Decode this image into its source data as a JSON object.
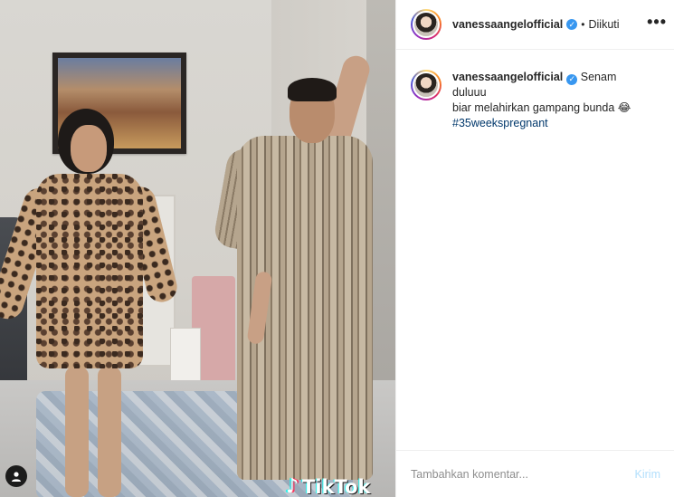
{
  "post": {
    "username": "vanessaangelofficial",
    "follow_separator": "•",
    "follow_status": "Diikuti",
    "more_icon": "•••",
    "caption_line1": "Senam duluuu",
    "caption_line2": "biar melahirkan gampang bunda",
    "caption_emoji": "😂",
    "hashtag": "#35weekspregnant"
  },
  "media": {
    "watermark": "TikTok",
    "watermark_icon": "tiktok-note-icon"
  },
  "comment": {
    "placeholder": "Tambahkan komentar...",
    "send_label": "Kirim"
  },
  "colors": {
    "link": "#00376b",
    "verified": "#3897f0",
    "send_disabled": "#b2dffc"
  }
}
